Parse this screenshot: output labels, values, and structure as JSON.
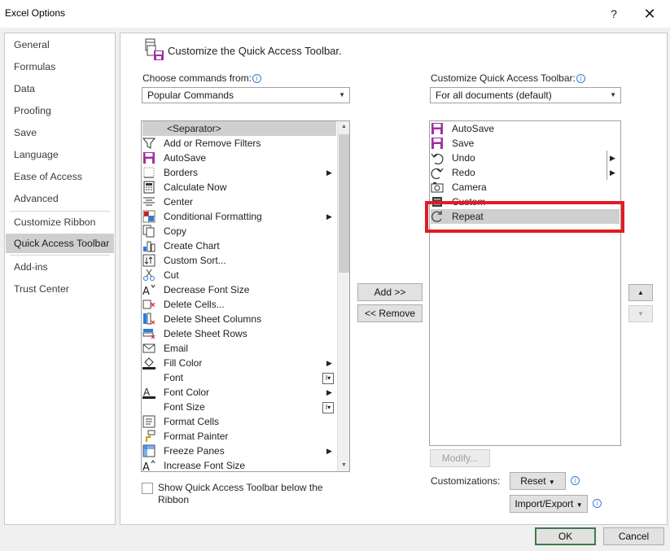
{
  "window": {
    "title": "Excel Options",
    "help": "?",
    "close": "✕"
  },
  "nav": [
    {
      "label": "General"
    },
    {
      "label": "Formulas"
    },
    {
      "label": "Data"
    },
    {
      "label": "Proofing"
    },
    {
      "label": "Save"
    },
    {
      "label": "Language"
    },
    {
      "label": "Ease of Access"
    },
    {
      "label": "Advanced"
    },
    {
      "label": "Customize Ribbon"
    },
    {
      "label": "Quick Access Toolbar",
      "selected": true
    },
    {
      "label": "Add-ins"
    },
    {
      "label": "Trust Center"
    }
  ],
  "heading": "Customize the Quick Access Toolbar.",
  "left": {
    "label": "Choose commands from:",
    "combo_value": "Popular Commands",
    "items": [
      {
        "label": "<Separator>",
        "icon": "none",
        "selected": true
      },
      {
        "label": "Add or Remove Filters",
        "icon": "filter-icon"
      },
      {
        "label": "AutoSave",
        "icon": "save-icon"
      },
      {
        "label": "Borders",
        "icon": "borders-icon",
        "sub": "arrow"
      },
      {
        "label": "Calculate Now",
        "icon": "calculator-icon"
      },
      {
        "label": "Center",
        "icon": "align-center-icon"
      },
      {
        "label": "Conditional Formatting",
        "icon": "conditional-formatting-icon",
        "sub": "arrow"
      },
      {
        "label": "Copy",
        "icon": "copy-icon"
      },
      {
        "label": "Create Chart",
        "icon": "chart-icon"
      },
      {
        "label": "Custom Sort...",
        "icon": "sort-icon"
      },
      {
        "label": "Cut",
        "icon": "scissors-icon"
      },
      {
        "label": "Decrease Font Size",
        "icon": "decrease-font-icon"
      },
      {
        "label": "Delete Cells...",
        "icon": "delete-cells-icon"
      },
      {
        "label": "Delete Sheet Columns",
        "icon": "delete-columns-icon"
      },
      {
        "label": "Delete Sheet Rows",
        "icon": "delete-rows-icon"
      },
      {
        "label": "Email",
        "icon": "email-icon"
      },
      {
        "label": "Fill Color",
        "icon": "fill-color-icon",
        "sub": "arrow"
      },
      {
        "label": "Font",
        "icon": "none",
        "sub": "field"
      },
      {
        "label": "Font Color",
        "icon": "font-color-icon",
        "sub": "arrow"
      },
      {
        "label": "Font Size",
        "icon": "none",
        "sub": "field"
      },
      {
        "label": "Format Cells",
        "icon": "format-cells-icon"
      },
      {
        "label": "Format Painter",
        "icon": "format-painter-icon"
      },
      {
        "label": "Freeze Panes",
        "icon": "freeze-panes-icon",
        "sub": "arrow"
      },
      {
        "label": "Increase Font Size",
        "icon": "increase-font-icon"
      }
    ]
  },
  "right": {
    "label": "Customize Quick Access Toolbar:",
    "combo_value": "For all documents (default)",
    "items": [
      {
        "label": "AutoSave",
        "icon": "save-icon"
      },
      {
        "label": "Save",
        "icon": "save-icon"
      },
      {
        "label": "Undo",
        "icon": "undo-icon",
        "sub": "split"
      },
      {
        "label": "Redo",
        "icon": "redo-icon",
        "sub": "split"
      },
      {
        "label": "Camera",
        "icon": "camera-icon"
      },
      {
        "label": "Custom",
        "icon": "custom-icon"
      },
      {
        "label": "Repeat",
        "icon": "repeat-icon",
        "selected": true
      }
    ]
  },
  "buttons": {
    "add": "Add >>",
    "remove": "<< Remove",
    "modify": "Modify...",
    "reset": "Reset",
    "import_export": "Import/Export",
    "ok": "OK",
    "cancel": "Cancel"
  },
  "show_below_label": "Show Quick Access Toolbar below the Ribbon",
  "customizations_label": "Customizations:",
  "colors": {
    "highlight": "#e21b24",
    "save_purple": "#a0309f",
    "selected_row": "#cfcfcf"
  }
}
